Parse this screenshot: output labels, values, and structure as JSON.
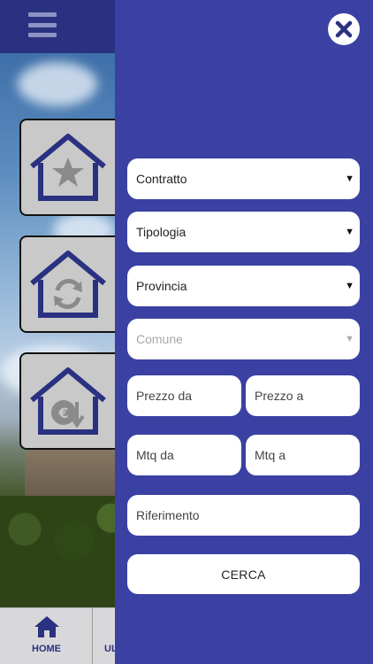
{
  "background": {
    "menu_icon": "hamburger-icon",
    "cards": [
      {
        "icon": "house-star-icon"
      },
      {
        "icon": "house-refresh-icon"
      },
      {
        "icon": "house-euro-icon"
      }
    ],
    "bottom_nav": {
      "home_label": "HOME",
      "home_icon": "home-icon",
      "second_label": "UL"
    }
  },
  "drawer": {
    "close_icon": "close-icon",
    "selects": {
      "contratto": "Contratto",
      "tipologia": "Tipologia",
      "provincia": "Provincia",
      "comune": "Comune"
    },
    "inputs": {
      "prezzo_da": "Prezzo da",
      "prezzo_a": "Prezzo a",
      "mtq_da": "Mtq da",
      "mtq_a": "Mtq a",
      "riferimento": "Riferimento"
    },
    "search_label": "CERCA",
    "arrow_glyph": "▼"
  },
  "colors": {
    "drawer_bg": "#3a41a3",
    "topbar_bg": "#2a3180",
    "accent": "#2a3180"
  }
}
